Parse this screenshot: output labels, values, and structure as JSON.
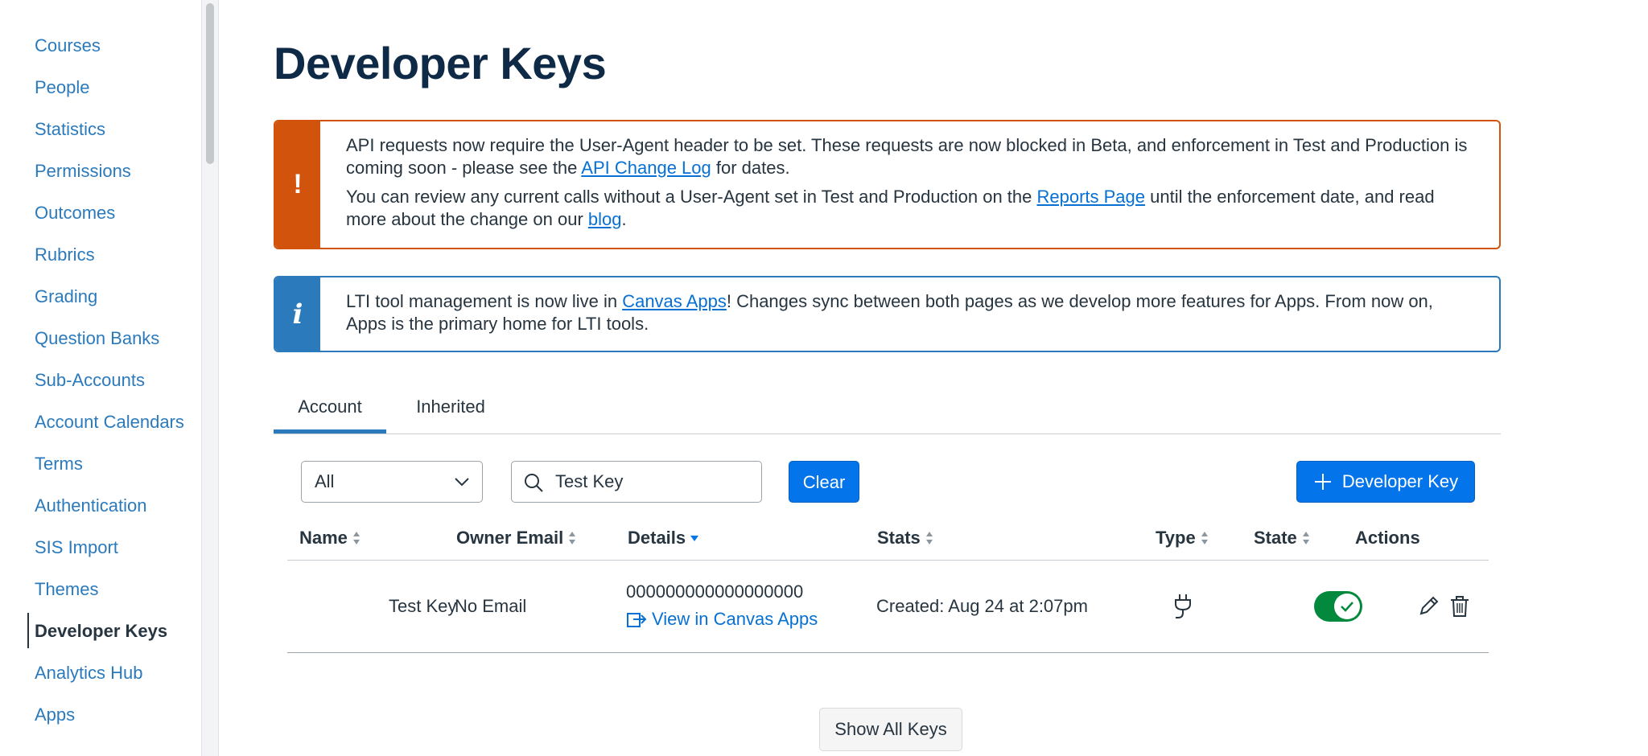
{
  "sidebar": {
    "items": [
      {
        "label": "Courses",
        "active": false
      },
      {
        "label": "People",
        "active": false
      },
      {
        "label": "Statistics",
        "active": false
      },
      {
        "label": "Permissions",
        "active": false
      },
      {
        "label": "Outcomes",
        "active": false
      },
      {
        "label": "Rubrics",
        "active": false
      },
      {
        "label": "Grading",
        "active": false
      },
      {
        "label": "Question Banks",
        "active": false
      },
      {
        "label": "Sub-Accounts",
        "active": false
      },
      {
        "label": "Account Calendars",
        "active": false
      },
      {
        "label": "Terms",
        "active": false
      },
      {
        "label": "Authentication",
        "active": false
      },
      {
        "label": "SIS Import",
        "active": false
      },
      {
        "label": "Themes",
        "active": false
      },
      {
        "label": "Developer Keys",
        "active": true
      },
      {
        "label": "Analytics Hub",
        "active": false
      },
      {
        "label": "Apps",
        "active": false
      }
    ]
  },
  "page": {
    "title": "Developer Keys"
  },
  "warning_alert": {
    "icon": "exclamation-icon",
    "p1_text_a": "API requests now require the User-Agent header to be set. These requests are now blocked in Beta, and enforcement in Test and Production is coming soon - please see the ",
    "p1_link": "API Change Log",
    "p1_text_b": " for dates.",
    "p2_text_a": "You can review any current calls without a User-Agent set in Test and Production on the ",
    "p2_link": "Reports Page",
    "p2_text_b": " until the enforcement date, and read more about the change on our ",
    "p2_link2": "blog",
    "p2_text_c": "."
  },
  "info_alert": {
    "icon": "info-icon",
    "text_a": "LTI tool management is now live in ",
    "link": "Canvas Apps",
    "text_b": "! Changes sync between both pages as we develop more features for Apps. From now on, Apps is the primary home for LTI tools."
  },
  "tabs": [
    {
      "label": "Account",
      "active": true
    },
    {
      "label": "Inherited",
      "active": false
    }
  ],
  "filters": {
    "type_select": "All",
    "search_value": "Test Key",
    "clear_label": "Clear",
    "add_label": "Developer Key"
  },
  "table": {
    "headers": {
      "name": "Name",
      "owner_email": "Owner Email",
      "details": "Details",
      "stats": "Stats",
      "type": "Type",
      "state": "State",
      "actions": "Actions"
    },
    "rows": [
      {
        "name": "Test Key",
        "owner_email": "No Email",
        "details_id": "000000000000000000",
        "details_link": "View in Canvas Apps",
        "stats": "Created: Aug 24 at 2:07pm",
        "type_icon": "plug-icon",
        "state_on": true
      }
    ]
  },
  "footer": {
    "show_all_label": "Show All Keys"
  },
  "colors": {
    "warning": "#d1530c",
    "info": "#2b7abc",
    "primary_button": "#0374e9",
    "toggle_on": "#03893d",
    "link": "#0770d3"
  }
}
